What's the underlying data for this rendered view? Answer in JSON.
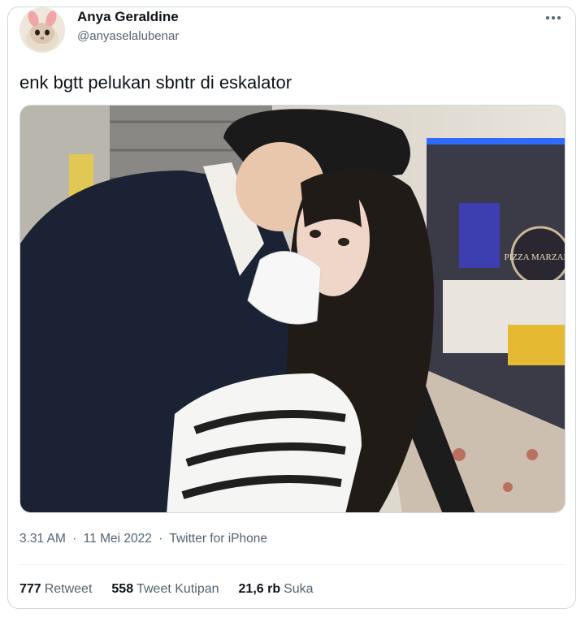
{
  "author": {
    "name": "Anya Geraldine",
    "handle": "@anyaselalubenar"
  },
  "tweet": {
    "text": "enk bgtt pelukan sbntr di eskalator"
  },
  "meta": {
    "time": "3.31 AM",
    "date": "11 Mei 2022",
    "source": "Twitter for iPhone",
    "separator": "·"
  },
  "stats": {
    "retweets_count": "777",
    "retweets_label": "Retweet",
    "quotes_count": "558",
    "quotes_label": "Tweet Kutipan",
    "likes_count": "21,6 rb",
    "likes_label": "Suka"
  },
  "media": {
    "sign_text": "PIZZA MARZANO"
  },
  "colors": {
    "text_primary": "#0f1419",
    "text_secondary": "#536471",
    "border": "#cfd9de",
    "neon": "#2f6bff"
  },
  "icons": {
    "more": "more-dots-icon"
  }
}
